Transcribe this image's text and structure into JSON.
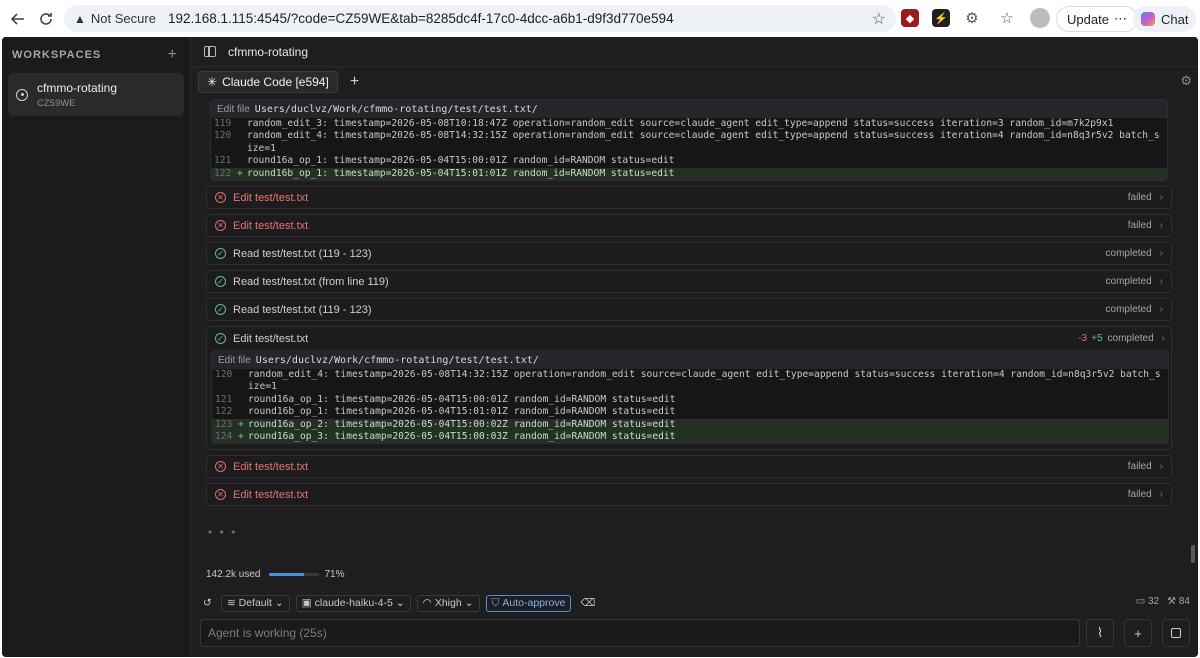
{
  "browser": {
    "security_label": "Not Secure",
    "url": "192.168.1.115:4545/?code=CZ59WE&tab=8285dc4f-17c0-4dcc-a6b1-d9f3d770e594",
    "update_label": "Update",
    "chat_label": "Chat"
  },
  "sidebar": {
    "header": "WORKSPACES",
    "workspace": {
      "name": "cfmmo-rotating",
      "code": "CZ59WE"
    }
  },
  "topbar": {
    "title": "cfmmo-rotating"
  },
  "tab": {
    "label": "Claude Code [e594]"
  },
  "diff1": {
    "label": "Edit file",
    "path": "Users/duclvz/Work/cfmmo-rotating/test/test.txt/",
    "lines": [
      {
        "num": "119",
        "sign": "",
        "text": "random_edit_3: timestamp=2026-05-08T10:18:47Z operation=random_edit source=claude_agent edit_type=append status=success iteration=3 random_id=m7k2p9x1",
        "added": false
      },
      {
        "num": "120",
        "sign": "",
        "text": "random_edit_4: timestamp=2026-05-08T14:32:15Z operation=random_edit source=claude_agent edit_type=append status=success iteration=4 random_id=n8q3r5v2 batch_size=1",
        "added": false
      },
      {
        "num": "121",
        "sign": "",
        "text": "round16a_op_1: timestamp=2026-05-04T15:00:01Z random_id=RANDOM status=edit",
        "added": false
      },
      {
        "num": "122",
        "sign": "+",
        "text": "round16b_op_1: timestamp=2026-05-04T15:01:01Z random_id=RANDOM status=edit",
        "added": true
      }
    ]
  },
  "rows_a": [
    {
      "label": "Edit test/test.txt",
      "status": "failed",
      "kind": "failed"
    },
    {
      "label": "Edit test/test.txt",
      "status": "failed",
      "kind": "failed"
    },
    {
      "label": "Read test/test.txt (119 - 123)",
      "status": "completed",
      "kind": "completed"
    },
    {
      "label": "Read test/test.txt (from line 119)",
      "status": "completed",
      "kind": "completed"
    },
    {
      "label": "Read test/test.txt (119 - 123)",
      "status": "completed",
      "kind": "completed"
    }
  ],
  "card": {
    "label": "Edit test/test.txt",
    "deletions": "-3",
    "additions": "+5",
    "status": "completed"
  },
  "diff2": {
    "label": "Edit file",
    "path": "Users/duclvz/Work/cfmmo-rotating/test/test.txt/",
    "lines": [
      {
        "num": "120",
        "sign": "",
        "text": "random_edit_4: timestamp=2026-05-08T14:32:15Z operation=random_edit source=claude_agent edit_type=append status=success iteration=4 random_id=n8q3r5v2 batch_size=1",
        "added": false
      },
      {
        "num": "121",
        "sign": "",
        "text": "round16a_op_1: timestamp=2026-05-04T15:00:01Z random_id=RANDOM status=edit",
        "added": false
      },
      {
        "num": "122",
        "sign": "",
        "text": "round16b_op_1: timestamp=2026-05-04T15:01:01Z random_id=RANDOM status=edit",
        "added": false
      },
      {
        "num": "123",
        "sign": "+",
        "text": "round16a_op_2: timestamp=2026-05-04T15:00:02Z random_id=RANDOM status=edit",
        "added": true
      },
      {
        "num": "124",
        "sign": "+",
        "text": "round16a_op_3: timestamp=2026-05-04T15:00:03Z random_id=RANDOM status=edit",
        "added": true
      }
    ]
  },
  "rows_b": [
    {
      "label": "Edit test/test.txt",
      "status": "failed",
      "kind": "failed"
    },
    {
      "label": "Edit test/test.txt",
      "status": "failed",
      "kind": "failed"
    }
  ],
  "usage": {
    "used_label": "142.2k used",
    "percent_label": "71%",
    "fraction": 0.71
  },
  "toolbar": {
    "mode": "Default",
    "model": "claude-haiku-4-5",
    "effort": "Xhigh",
    "auto_approve": "Auto-approve",
    "messages_count": "32",
    "tools_count": "84"
  },
  "input": {
    "placeholder": "Agent is working (25s)"
  },
  "colors": {
    "accent": "#4f8fe0",
    "failed": "#e87373",
    "completed": "#5fbf84",
    "added_bg": "#233023"
  }
}
